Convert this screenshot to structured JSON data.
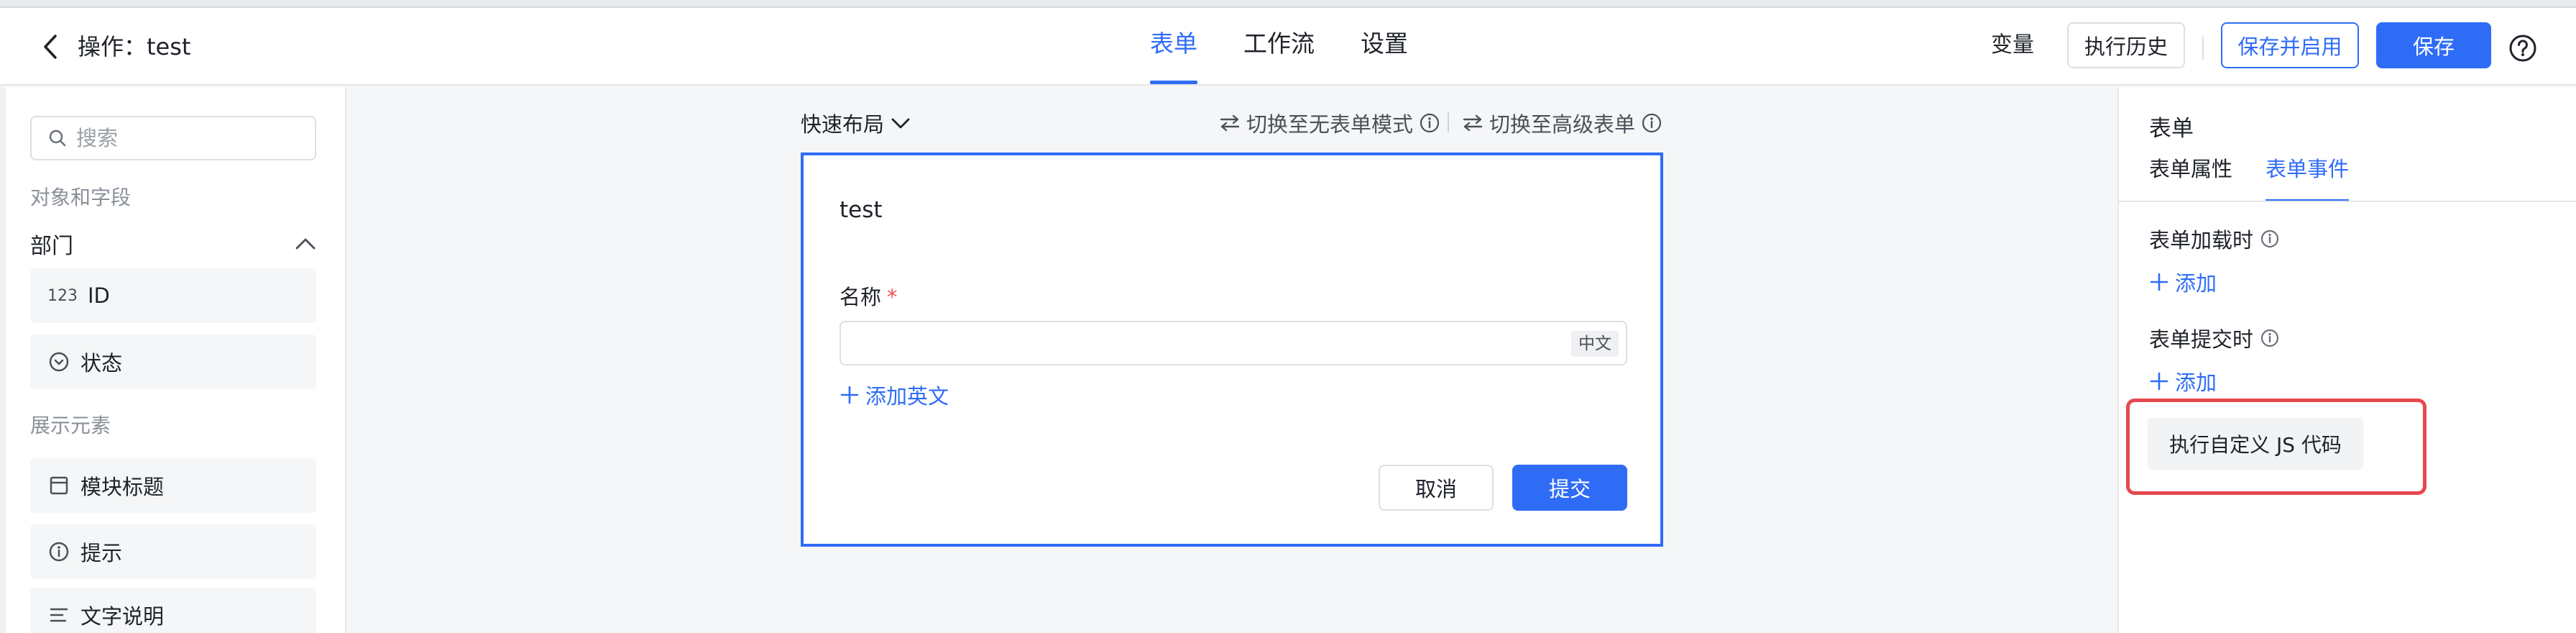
{
  "header": {
    "title": "操作：test",
    "tabs": [
      {
        "label": "表单",
        "active": true
      },
      {
        "label": "工作流",
        "active": false
      },
      {
        "label": "设置",
        "active": false
      }
    ],
    "variables_label": "变量",
    "history_label": "执行历史",
    "save_enable_label": "保存并启用",
    "save_label": "保存"
  },
  "left_panel": {
    "search_placeholder": "搜索",
    "objects_section": "对象和字段",
    "group_name": "部门",
    "fields": [
      {
        "icon_text": "123",
        "label": "ID"
      },
      {
        "icon": "chevron-circle-icon",
        "label": "状态"
      }
    ],
    "elements_section": "展示元素",
    "elements": [
      {
        "icon": "block-title-icon",
        "label": "模块标题"
      },
      {
        "icon": "info-icon",
        "label": "提示"
      },
      {
        "icon": "text-lines-icon",
        "label": "文字说明"
      }
    ]
  },
  "canvas": {
    "layout_label": "快速布局",
    "switch_no_form": "切换至无表单模式",
    "switch_advanced": "切换至高级表单",
    "form": {
      "title": "test",
      "field_label": "名称",
      "required_mark": "*",
      "lang_tag": "中文",
      "add_english": "添加英文",
      "cancel_label": "取消",
      "submit_label": "提交"
    }
  },
  "right_panel": {
    "title": "表单",
    "tabs": [
      {
        "label": "表单属性",
        "active": false
      },
      {
        "label": "表单事件",
        "active": true
      }
    ],
    "on_load_label": "表单加载时",
    "on_submit_label": "表单提交时",
    "add_label": "添加",
    "dropdown_item": "执行自定义 JS 代码"
  },
  "colors": {
    "accent": "#2f6cf6",
    "highlight": "#e5484d",
    "required": "#f05252"
  }
}
